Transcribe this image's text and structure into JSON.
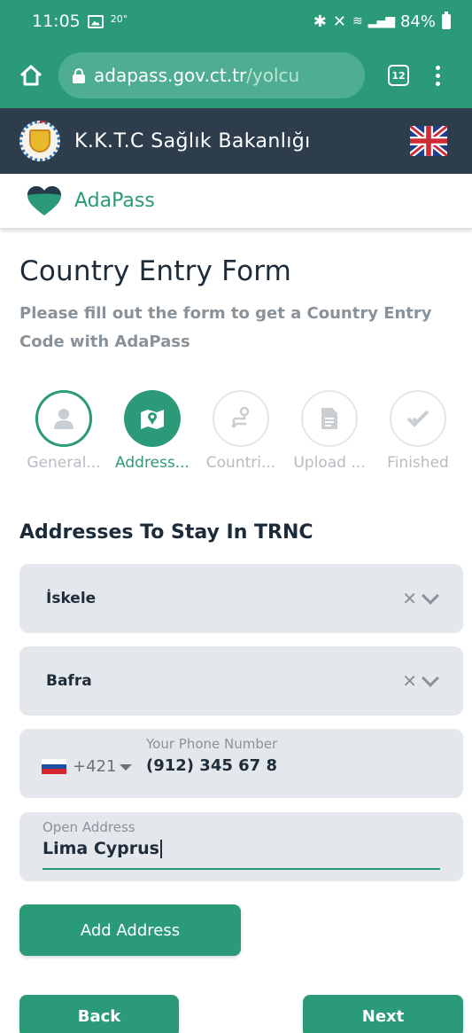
{
  "status_bar": {
    "time": "11:05",
    "temp": "20°",
    "battery": "84%"
  },
  "browser": {
    "url_host": "adapass.gov.ct.tr",
    "url_path": "/yolcu",
    "tab_count": "12"
  },
  "site": {
    "title": "K.K.T.C Sağlık Bakanlığı"
  },
  "app": {
    "name": "AdaPass"
  },
  "form": {
    "title": "Country Entry Form",
    "subtitle": "Please fill out the form to get a Country Entry Code with AdaPass"
  },
  "stepper": [
    {
      "label": "General...",
      "state": "done",
      "icon": "person-icon"
    },
    {
      "label": "Address...",
      "state": "active",
      "icon": "map-pin-icon"
    },
    {
      "label": "Countri...",
      "state": "todo",
      "icon": "route-icon"
    },
    {
      "label": "Upload ...",
      "state": "todo",
      "icon": "document-icon"
    },
    {
      "label": "Finished",
      "state": "todo",
      "icon": "check-icon"
    }
  ],
  "section": {
    "title": "Addresses To Stay In TRNC"
  },
  "fields": {
    "district": "İskele",
    "village": "Bafra",
    "phone_label": "Your Phone Number",
    "dial_code": "+421",
    "phone_value": "(912) 345 67 8",
    "address_label": "Open Address",
    "address_value": "Lima Cyprus"
  },
  "buttons": {
    "add_address": "Add Address",
    "back": "Back",
    "next": "Next"
  },
  "colors": {
    "primary": "#2a9a78",
    "header": "#2e3d4c",
    "field_bg": "#e4e7eb",
    "muted": "#8a9299"
  }
}
